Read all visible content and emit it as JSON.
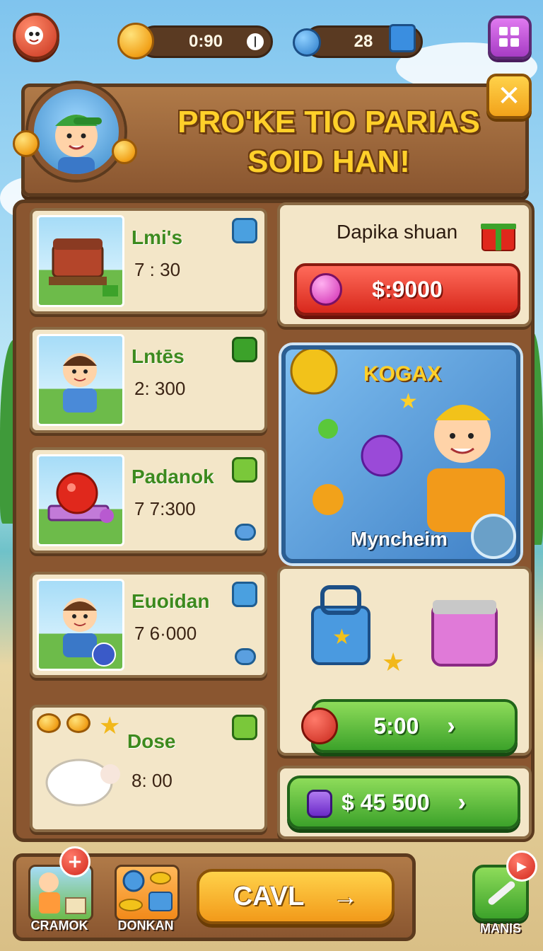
{
  "topbar": {
    "timer": "0:90",
    "gems": "28"
  },
  "banner": {
    "title_line1": "PRO'KE TIO PARIAS",
    "title_line2": "SOID HAN!"
  },
  "cards": [
    {
      "name": "Lmi's",
      "value": "7 : 30"
    },
    {
      "name": "Lntēs",
      "value": "2: 300"
    },
    {
      "name": "Padanok",
      "value": "7 7:300"
    },
    {
      "name": "Euoidan",
      "value": "7 6·000"
    },
    {
      "name": "Dose",
      "value": "8:  00"
    }
  ],
  "offer": {
    "label": "Dapika shuan",
    "price": "$:9000"
  },
  "featured": {
    "title": "KOGAX",
    "caption": "Myncheim"
  },
  "chest": {
    "price": "5:00"
  },
  "bundle": {
    "price": "$ 45 500"
  },
  "bottom": {
    "nav1_label": "CRAMOK",
    "nav2_label": "DONKAN",
    "main_button": "CAVL",
    "manis_label": "MANIS"
  }
}
